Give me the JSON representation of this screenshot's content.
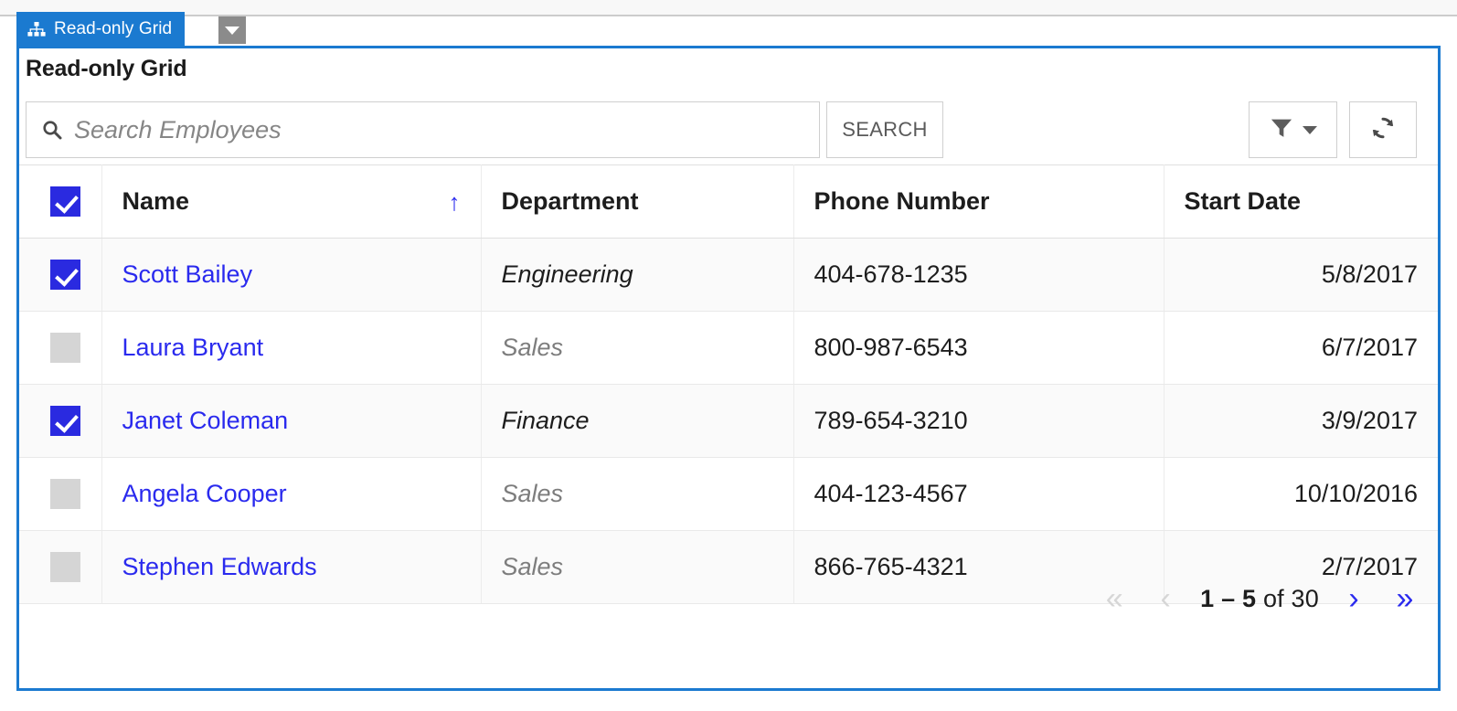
{
  "tab": {
    "label": "Read-only Grid",
    "icon": "sitemap-icon",
    "dropdown_icon": "chevron-down-icon",
    "active_color": "#1b7ad0"
  },
  "page": {
    "title": "Read-only Grid",
    "border_color": "#1b7ad0"
  },
  "toolbar": {
    "search_placeholder": "Search Employees",
    "search_value": "",
    "search_icon": "search-icon",
    "search_button_label": "SEARCH",
    "filter_icon": "funnel-icon",
    "filter_caret_icon": "chevron-down-icon",
    "refresh_icon": "refresh-icon"
  },
  "grid": {
    "select_all_checked": true,
    "sort_column": "Name",
    "sort_direction_icon": "arrow-up-icon",
    "columns": [
      {
        "key": "check",
        "label": ""
      },
      {
        "key": "name",
        "label": "Name"
      },
      {
        "key": "department",
        "label": "Department"
      },
      {
        "key": "phone",
        "label": "Phone Number"
      },
      {
        "key": "start_date",
        "label": "Start Date"
      }
    ],
    "rows": [
      {
        "checked": true,
        "name": "Scott Bailey",
        "department": "Engineering",
        "phone": "404-678-1235",
        "start_date": "5/8/2017"
      },
      {
        "checked": false,
        "name": "Laura Bryant",
        "department": "Sales",
        "phone": "800-987-6543",
        "start_date": "6/7/2017"
      },
      {
        "checked": true,
        "name": "Janet Coleman",
        "department": "Finance",
        "phone": "789-654-3210",
        "start_date": "3/9/2017"
      },
      {
        "checked": false,
        "name": "Angela Cooper",
        "department": "Sales",
        "phone": "404-123-4567",
        "start_date": "10/10/2016"
      },
      {
        "checked": false,
        "name": "Stephen Edwards",
        "department": "Sales",
        "phone": "866-765-4321",
        "start_date": "2/7/2017"
      }
    ]
  },
  "pager": {
    "first_label": "«",
    "prev_label": "‹",
    "next_label": "›",
    "last_label": "»",
    "first_enabled": false,
    "prev_enabled": false,
    "next_enabled": true,
    "last_enabled": true,
    "range": "1 – 5",
    "of_text": "of 30",
    "accent_color": "#2a2aee"
  }
}
